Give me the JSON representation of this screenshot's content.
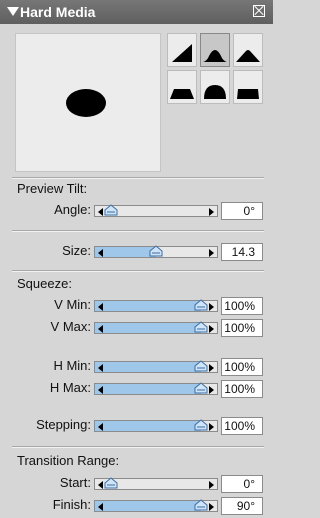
{
  "window": {
    "title": "Hard Media"
  },
  "sections": {
    "preview_tilt": "Preview Tilt:",
    "squeeze": "Squeeze:",
    "transition_range": "Transition Range:"
  },
  "controls": {
    "angle": {
      "label": "Angle:",
      "value": "0°",
      "position": 0.0
    },
    "size": {
      "label": "Size:",
      "value": "14.3",
      "position": 0.5
    },
    "v_min": {
      "label": "V Min:",
      "value": "100%",
      "position": 1.0
    },
    "v_max": {
      "label": "V Max:",
      "value": "100%",
      "position": 1.0
    },
    "h_min": {
      "label": "H Min:",
      "value": "100%",
      "position": 1.0
    },
    "h_max": {
      "label": "H Max:",
      "value": "100%",
      "position": 1.0
    },
    "stepping": {
      "label": "Stepping:",
      "value": "100%",
      "position": 1.0
    },
    "start": {
      "label": "Start:",
      "value": "0°",
      "position": 0.0
    },
    "finish": {
      "label": "Finish:",
      "value": "90°",
      "position": 1.0
    }
  },
  "shape_presets": [
    "triangle-icon",
    "rounded-mound-icon",
    "peak-icon",
    "trapezoid-icon",
    "dome-icon",
    "flat-block-icon"
  ],
  "selected_shape_index": 1,
  "colors": {
    "slider_fill": "#9ec7ea",
    "titlebar": "#6a6a6a",
    "background": "#d6d6d6"
  }
}
